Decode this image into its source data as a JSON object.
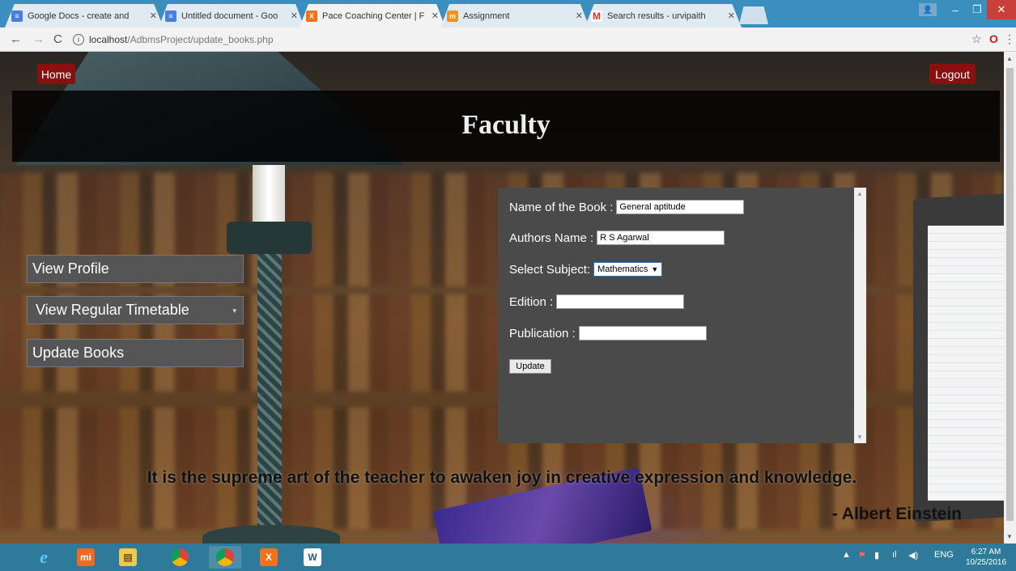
{
  "browser": {
    "tabs": [
      {
        "label": "Google Docs - create and",
        "icon": "docs-icon",
        "color": "#4a7fd9"
      },
      {
        "label": "Untitled document - Goo",
        "icon": "docs-icon",
        "color": "#4a7fd9"
      },
      {
        "label": "Pace Coaching Center | F",
        "icon": "xampp-icon",
        "color": "#f2721c"
      },
      {
        "label": "Assignment",
        "icon": "moodle-icon",
        "color": "#f29020"
      },
      {
        "label": "Search results - urvipaith",
        "icon": "gmail-icon",
        "color": "#d93025"
      }
    ],
    "url_host": "localhost",
    "url_path": "/AdbmsProject/update_books.php",
    "window_controls": {
      "minimize": "–",
      "maximize": "❐",
      "close": "✕"
    }
  },
  "page": {
    "home_label": "Home",
    "logout_label": "Logout",
    "title": "Faculty",
    "menu": [
      {
        "label": "View Profile"
      },
      {
        "label": "View Regular Timetable",
        "has_caret": true
      },
      {
        "label": "Update Books"
      }
    ],
    "form": {
      "book_name_label": "Name of the Book :",
      "book_name_value": "General aptitude",
      "author_label": "Authors Name :",
      "author_value": "R S Agarwal",
      "subject_label": "Select Subject:",
      "subject_value": "Mathematics",
      "edition_label": "Edition :",
      "edition_value": "",
      "publication_label": "Publication :",
      "publication_value": "",
      "update_label": "Update"
    },
    "quote": "It is the supreme art of the teacher to awaken joy in creative expression and knowledge.",
    "quote_author": "- Albert Einstein"
  },
  "taskbar": {
    "apps": [
      "ie-icon",
      "mi-icon",
      "file-explorer-icon",
      "chrome-icon",
      "chrome-icon",
      "xampp-icon",
      "word-icon"
    ],
    "language": "ENG",
    "time": "6:27 AM",
    "date": "10/25/2016"
  }
}
